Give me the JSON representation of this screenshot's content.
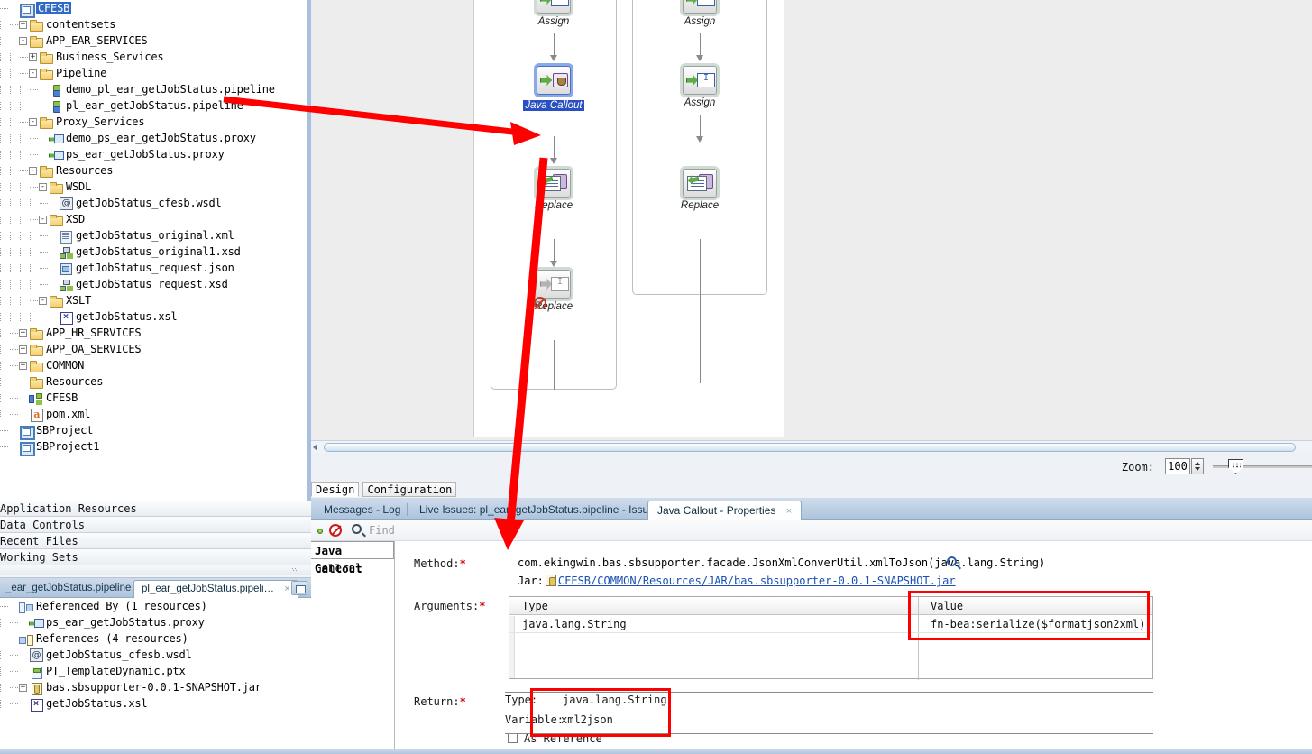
{
  "navigator": {
    "root": "CFESB",
    "items": [
      {
        "label": "CFESB",
        "indent": 0,
        "icon": "project-icon",
        "expander": "",
        "selected": true
      },
      {
        "label": "contentsets",
        "indent": 1,
        "icon": "folder-icon",
        "expander": "+"
      },
      {
        "label": "APP_EAR_SERVICES",
        "indent": 1,
        "icon": "folder-icon",
        "expander": "-"
      },
      {
        "label": "Business_Services",
        "indent": 2,
        "icon": "folder-icon",
        "expander": "+"
      },
      {
        "label": "Pipeline",
        "indent": 2,
        "icon": "folder-icon",
        "expander": "-"
      },
      {
        "label": "demo_pl_ear_getJobStatus.pipeline",
        "indent": 3,
        "icon": "pipeline-icon",
        "expander": ""
      },
      {
        "label": "pl_ear_getJobStatus.pipeline",
        "indent": 3,
        "icon": "pipeline-icon",
        "expander": ""
      },
      {
        "label": "Proxy_Services",
        "indent": 2,
        "icon": "folder-icon",
        "expander": "-"
      },
      {
        "label": "demo_ps_ear_getJobStatus.proxy",
        "indent": 3,
        "icon": "proxy-icon",
        "expander": ""
      },
      {
        "label": "ps_ear_getJobStatus.proxy",
        "indent": 3,
        "icon": "proxy-icon",
        "expander": ""
      },
      {
        "label": "Resources",
        "indent": 2,
        "icon": "folder-icon",
        "expander": "-"
      },
      {
        "label": "WSDL",
        "indent": 3,
        "icon": "folder-icon",
        "expander": "-"
      },
      {
        "label": "getJobStatus_cfesb.wsdl",
        "indent": 4,
        "icon": "at-icon",
        "expander": ""
      },
      {
        "label": "XSD",
        "indent": 3,
        "icon": "folder-icon",
        "expander": "-"
      },
      {
        "label": "getJobStatus_original.xml",
        "indent": 4,
        "icon": "xml-icon",
        "expander": ""
      },
      {
        "label": "getJobStatus_original1.xsd",
        "indent": 4,
        "icon": "xsd-icon",
        "expander": ""
      },
      {
        "label": "getJobStatus_request.json",
        "indent": 4,
        "icon": "json-icon",
        "expander": ""
      },
      {
        "label": "getJobStatus_request.xsd",
        "indent": 4,
        "icon": "xsd-icon",
        "expander": ""
      },
      {
        "label": "XSLT",
        "indent": 3,
        "icon": "folder-icon",
        "expander": "-"
      },
      {
        "label": "getJobStatus.xsl",
        "indent": 4,
        "icon": "xsl-icon",
        "expander": ""
      },
      {
        "label": "APP_HR_SERVICES",
        "indent": 1,
        "icon": "folder-icon",
        "expander": "+"
      },
      {
        "label": "APP_OA_SERVICES",
        "indent": 1,
        "icon": "folder-icon",
        "expander": "+"
      },
      {
        "label": "COMMON",
        "indent": 1,
        "icon": "folder-icon",
        "expander": "+"
      },
      {
        "label": "Resources",
        "indent": 1,
        "icon": "folder-icon",
        "expander": ""
      },
      {
        "label": "CFESB",
        "indent": 1,
        "icon": "cfesb-icon",
        "expander": ""
      },
      {
        "label": "pom.xml",
        "indent": 1,
        "icon": "pom-icon",
        "expander": ""
      },
      {
        "label": "SBProject",
        "indent": 0,
        "icon": "project-icon",
        "expander": ""
      },
      {
        "label": "SBProject1",
        "indent": 0,
        "icon": "project-icon",
        "expander": ""
      }
    ]
  },
  "accordion": {
    "items": [
      {
        "label": "Application Resources"
      },
      {
        "label": "Data Controls"
      },
      {
        "label": "Recent Files"
      },
      {
        "label": "Working Sets"
      }
    ]
  },
  "structure_dock": {
    "tabs": [
      {
        "label": "_ear_getJobStatus.pipeline…",
        "active": false
      },
      {
        "label": "pl_ear_getJobStatus.pipeli…",
        "active": true,
        "close": "×"
      }
    ],
    "items": [
      {
        "label": "Referenced By (1 resources)",
        "indent": 0,
        "icon": "referenced-by-icon",
        "expander": ""
      },
      {
        "label": "ps_ear_getJobStatus.proxy",
        "indent": 1,
        "icon": "proxy-icon",
        "expander": ""
      },
      {
        "label": "References (4 resources)",
        "indent": 0,
        "icon": "references-icon",
        "expander": ""
      },
      {
        "label": "getJobStatus_cfesb.wsdl",
        "indent": 1,
        "icon": "at-icon",
        "expander": ""
      },
      {
        "label": "PT_TemplateDynamic.ptx",
        "indent": 1,
        "icon": "ptx-icon",
        "expander": ""
      },
      {
        "label": "bas.sbsupporter-0.0.1-SNAPSHOT.jar",
        "indent": 1,
        "icon": "jar-icon",
        "expander": "+"
      },
      {
        "label": "getJobStatus.xsl",
        "indent": 1,
        "icon": "xsl-icon",
        "expander": ""
      }
    ]
  },
  "editor": {
    "flow_nodes": [
      {
        "id": "assign-1",
        "label": "Assign",
        "lane": "left",
        "glyph": "assign-node-icon",
        "selected": false,
        "disabled": false
      },
      {
        "id": "java-callout",
        "label": "Java Callout",
        "lane": "left",
        "glyph": "java-callout-node-icon",
        "selected": true,
        "disabled": false
      },
      {
        "id": "replace-1",
        "label": "Replace",
        "lane": "left",
        "glyph": "replace-node-icon",
        "selected": false,
        "disabled": false
      },
      {
        "id": "replace-2",
        "label": "Replace",
        "lane": "left",
        "glyph": "assign-node-icon",
        "selected": false,
        "disabled": true
      },
      {
        "id": "assign-2",
        "label": "Assign",
        "lane": "right",
        "glyph": "assign-node-icon",
        "selected": false,
        "disabled": false
      },
      {
        "id": "assign-3",
        "label": "Assign",
        "lane": "right",
        "glyph": "assign-node-icon",
        "selected": false,
        "disabled": false
      },
      {
        "id": "replace-3",
        "label": "Replace",
        "lane": "right",
        "glyph": "replace-node-icon",
        "selected": false,
        "disabled": false
      }
    ],
    "zoom": {
      "label": "Zoom:",
      "value": "100"
    },
    "view_tabs": [
      {
        "label": "Design",
        "active": true
      },
      {
        "label": "Configuration",
        "active": false
      }
    ]
  },
  "dock": {
    "tabs": [
      {
        "label": "Messages - Log",
        "active": false
      },
      {
        "label": "Live Issues: pl_ear_getJobStatus.pipeline - Issues",
        "active": false
      },
      {
        "label": "Java Callout - Properties",
        "active": true,
        "close": "×"
      }
    ],
    "find": {
      "placeholder": "Find",
      "value": ""
    },
    "nav": [
      {
        "label": "Java Callout",
        "active": true
      },
      {
        "label": "General",
        "active": false
      }
    ],
    "form": {
      "method_label": "Method:",
      "method_value": "com.ekingwin.bas.sbsupporter.facade.JsonXmlConverUtil.xmlToJson(java.lang.String)",
      "jar_label": "Jar:",
      "jar_value": "CFESB/COMMON/Resources/JAR/bas.sbsupporter-0.0.1-SNAPSHOT.jar",
      "arguments_label": "Arguments:",
      "arg_columns": [
        "Type",
        "Value"
      ],
      "arg_rows": [
        {
          "type": "java.lang.String",
          "value": "fn-bea:serialize($formatjson2xml)"
        }
      ],
      "return_label": "Return:",
      "return_type_label": "Type:",
      "return_type_value": "java.lang.String",
      "return_variable_label": "Variable:",
      "return_variable_value": "xml2json",
      "as_reference_label": "As Reference",
      "as_reference_checked": false,
      "required_marker": "*"
    }
  },
  "annotations": {
    "highlight_color": "#ff0000",
    "boxes": [
      "argument-value-box",
      "return-values-box"
    ],
    "arrows": [
      "tree-to-java-callout-arrow",
      "java-callout-to-properties-arrow"
    ]
  }
}
